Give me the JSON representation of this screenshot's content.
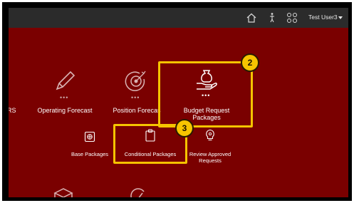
{
  "header": {
    "user_label": "Test User3",
    "icons": [
      "home-icon",
      "accessibility-icon",
      "apps-grid-icon",
      "chevron-down-icon"
    ]
  },
  "tiles": {
    "partial_left": "RS",
    "operating_forecast": "Operating Forecast",
    "position_forecast": "Position Forecas",
    "budget_request_line1": "Budget Request",
    "budget_request_line2": "Packages"
  },
  "sub_tiles": {
    "base_packages": "Base Packages",
    "conditional_packages": "Conditional Packages",
    "review_line1": "Review Approved",
    "review_line2": "Requests"
  },
  "callouts": {
    "step_2": "2",
    "step_3": "3"
  },
  "colors": {
    "background": "#7a0000",
    "topbar": "#2b2b2b",
    "highlight": "#f5c400"
  }
}
